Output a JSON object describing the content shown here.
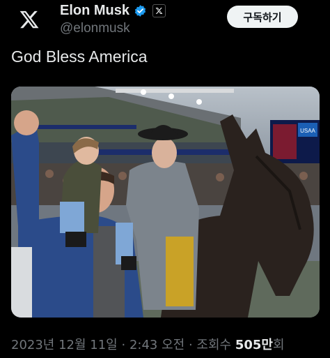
{
  "author": {
    "display_name": "Elon Musk",
    "handle": "@elonmusk",
    "avatar_icon": "x-logo-icon",
    "verified_icon": "verified-badge-icon",
    "affiliation_icon": "x-affiliate-badge-icon",
    "verified_color": "#1d9bf0"
  },
  "actions": {
    "subscribe_label": "구독하기"
  },
  "tweet": {
    "text": "God Bless America"
  },
  "media": {
    "alt": "Man with child on shoulders raising fist beside a cadet on a black horse in a stadium",
    "scoreboard_text": "USAA"
  },
  "meta": {
    "date": "2023년 12월 11일",
    "separator": "·",
    "time": "2:43 오전",
    "views_label": "조회수",
    "views_count": "505만",
    "views_suffix": "회"
  }
}
